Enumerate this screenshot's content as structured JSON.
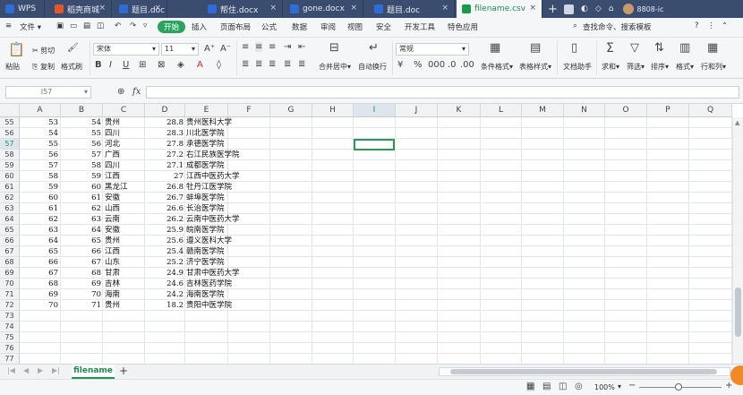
{
  "tabs": [
    {
      "label": "WPS",
      "color": "#2f6bd9"
    },
    {
      "label": "稻壳商城",
      "color": "#e8522d"
    },
    {
      "label": "题目.doc",
      "color": "#2f6bd9"
    },
    {
      "label": "帮住.docx",
      "color": "#2f6bd9"
    },
    {
      "label": "gone.docx",
      "color": "#2f6bd9"
    },
    {
      "label": "题目.doc",
      "color": "#2f6bd9"
    },
    {
      "label": "filename.csv",
      "color": "#1a9a4c"
    }
  ],
  "titlebar_right": {
    "user": "8808-ic",
    "new_tab": "+"
  },
  "menu": {
    "file": "文件",
    "items": [
      "开始",
      "插入",
      "页面布局",
      "公式",
      "数据",
      "审阅",
      "视图",
      "安全",
      "开发工具",
      "特色应用"
    ],
    "search": "查找命令、搜索模板"
  },
  "ribbon": {
    "paste": "粘贴",
    "cut": "剪切",
    "copy": "复制",
    "format_painter": "格式刷",
    "font_name": "宋体",
    "font_size": "11",
    "merge_center": "合并居中",
    "wrap": "自动换行",
    "number_format": "常规",
    "cond_format": "条件格式",
    "table_style": "表格样式",
    "doc_helper": "文档助手",
    "sum": "求和",
    "filter": "筛选",
    "sort": "排序",
    "format": "格式",
    "rowcol": "行和列"
  },
  "formula_bar": {
    "name_box": "I57",
    "fx": "fx",
    "content": ""
  },
  "columns": [
    "A",
    "B",
    "C",
    "D",
    "E",
    "F",
    "G",
    "H",
    "I",
    "J",
    "K",
    "L",
    "M",
    "N",
    "O",
    "P",
    "Q"
  ],
  "selected_column": "I",
  "selected_row": "57",
  "row_numbers": [
    "55",
    "56",
    "57",
    "58",
    "59",
    "60",
    "61",
    "62",
    "63",
    "64",
    "65",
    "66",
    "67",
    "68",
    "69",
    "70",
    "71",
    "72",
    "73",
    "74",
    "75",
    "76",
    "77"
  ],
  "rows": [
    {
      "a": "53",
      "b": "54",
      "c": "贵州",
      "d": "28.8",
      "e": "贵州医科大学"
    },
    {
      "a": "54",
      "b": "55",
      "c": "四川",
      "d": "28.3",
      "e": "川北医学院"
    },
    {
      "a": "55",
      "b": "56",
      "c": "河北",
      "d": "27.8",
      "e": "承德医学院"
    },
    {
      "a": "56",
      "b": "57",
      "c": "广西",
      "d": "27.2",
      "e": "右江民族医学院"
    },
    {
      "a": "57",
      "b": "58",
      "c": "四川",
      "d": "27.1",
      "e": "成都医学院"
    },
    {
      "a": "58",
      "b": "59",
      "c": "江西",
      "d": "27",
      "e": "江西中医药大学"
    },
    {
      "a": "59",
      "b": "60",
      "c": "黑龙江",
      "d": "26.8",
      "e": "牡丹江医学院"
    },
    {
      "a": "60",
      "b": "61",
      "c": "安徽",
      "d": "26.7",
      "e": "蚌埠医学院"
    },
    {
      "a": "61",
      "b": "62",
      "c": "山西",
      "d": "26.6",
      "e": "长治医学院"
    },
    {
      "a": "62",
      "b": "63",
      "c": "云南",
      "d": "26.2",
      "e": "云南中医药大学"
    },
    {
      "a": "63",
      "b": "64",
      "c": "安徽",
      "d": "25.9",
      "e": "皖南医学院"
    },
    {
      "a": "64",
      "b": "65",
      "c": "贵州",
      "d": "25.6",
      "e": "遵义医科大学"
    },
    {
      "a": "65",
      "b": "66",
      "c": "江西",
      "d": "25.4",
      "e": "赣南医学院"
    },
    {
      "a": "66",
      "b": "67",
      "c": "山东",
      "d": "25.2",
      "e": "济宁医学院"
    },
    {
      "a": "67",
      "b": "68",
      "c": "甘肃",
      "d": "24.9",
      "e": "甘肃中医药大学"
    },
    {
      "a": "68",
      "b": "69",
      "c": "吉林",
      "d": "24.6",
      "e": "吉林医药学院"
    },
    {
      "a": "69",
      "b": "70",
      "c": "海南",
      "d": "24.2",
      "e": "海南医学院"
    },
    {
      "a": "70",
      "b": "71",
      "c": "贵州",
      "d": "18.2",
      "e": "贵阳中医学院"
    }
  ],
  "sheet_tab": "filename",
  "status": {
    "zoom": "100%"
  }
}
